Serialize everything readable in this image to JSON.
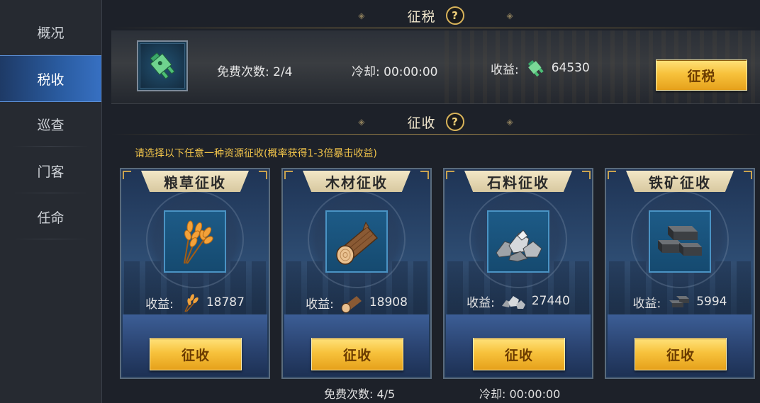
{
  "sidebar": {
    "items": [
      {
        "label": "概况",
        "active": false
      },
      {
        "label": "税收",
        "active": true
      },
      {
        "label": "巡查",
        "active": false
      },
      {
        "label": "门客",
        "active": false
      },
      {
        "label": "任命",
        "active": false
      }
    ]
  },
  "tax_section": {
    "title": "征税",
    "help_symbol": "?",
    "free_label": "免费次数: 2/4",
    "cooldown_label": "冷却: 00:00:00",
    "income_label": "收益:",
    "income_value": "64530",
    "button_label": "征税"
  },
  "collect_section": {
    "title": "征收",
    "help_symbol": "?",
    "subtitle": "请选择以下任意一种资源征收(概率获得1-3倍暴击收益)",
    "cards": [
      {
        "title": "粮草征收",
        "icon": "wheat-icon",
        "income_label": "收益:",
        "income_value": "18787",
        "button_label": "征收"
      },
      {
        "title": "木材征收",
        "icon": "wood-log-icon",
        "income_label": "收益:",
        "income_value": "18908",
        "button_label": "征收"
      },
      {
        "title": "石料征收",
        "icon": "stone-icon",
        "income_label": "收益:",
        "income_value": "27440",
        "button_label": "征收"
      },
      {
        "title": "铁矿征收",
        "icon": "iron-ingot-icon",
        "income_label": "收益:",
        "income_value": "5994",
        "button_label": "征收"
      }
    ]
  },
  "footer": {
    "free_label": "免费次数: 4/5",
    "cooldown_label": "冷却: 00:00:00"
  },
  "colors": {
    "accent_gold": "#f7c23c",
    "active_tab": "#2a5ca1",
    "subtitle": "#f0c34a"
  }
}
